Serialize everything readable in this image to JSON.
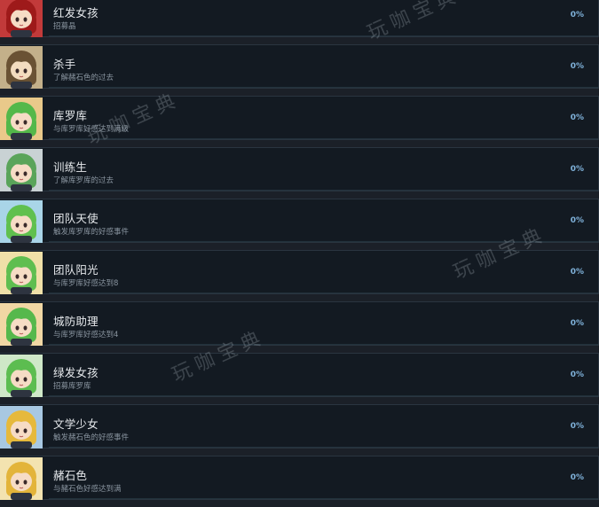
{
  "achievements": [
    {
      "title": "红发女孩",
      "desc": "招募晶",
      "percent": "0%",
      "avatar_icon": "red-hair-girl-portrait",
      "bg": "#c23a3a",
      "hair": "#9e1a1a",
      "skin": "#f6dcc5"
    },
    {
      "title": "杀手",
      "desc": "了解赭石色的过去",
      "percent": "0%",
      "avatar_icon": "assassin-portrait",
      "bg": "#c3b08a",
      "hair": "#6a5234",
      "skin": "#f3dcbf"
    },
    {
      "title": "库罗库",
      "desc": "与库罗库好感达到满级",
      "percent": "0%",
      "avatar_icon": "green-hair-girl-portrait",
      "bg": "#e9c98a",
      "hair": "#54b84a",
      "skin": "#f6dcc5"
    },
    {
      "title": "训练生",
      "desc": "了解库罗库的过去",
      "percent": "0%",
      "avatar_icon": "trainee-portrait",
      "bg": "#c9d2d4",
      "hair": "#5aa45a",
      "skin": "#f6dcc5"
    },
    {
      "title": "团队天使",
      "desc": "触发库罗库的好感事件",
      "percent": "0%",
      "avatar_icon": "green-hair-girl-portrait",
      "bg": "#a9d5e8",
      "hair": "#60c04e",
      "skin": "#f6dcc5"
    },
    {
      "title": "团队阳光",
      "desc": "与库罗库好感达到8",
      "percent": "0%",
      "avatar_icon": "green-hair-girl-portrait",
      "bg": "#f0e0a8",
      "hair": "#5fbe50",
      "skin": "#f6dcc5"
    },
    {
      "title": "城防助理",
      "desc": "与库罗库好感达到4",
      "percent": "0%",
      "avatar_icon": "green-hair-girl-portrait",
      "bg": "#f1d7a4",
      "hair": "#56b84c",
      "skin": "#f6dcc5"
    },
    {
      "title": "绿发女孩",
      "desc": "招募库罗库",
      "percent": "0%",
      "avatar_icon": "green-hair-girl-portrait",
      "bg": "#cfe8c8",
      "hair": "#5cbd50",
      "skin": "#f6dcc5"
    },
    {
      "title": "文学少女",
      "desc": "触发赭石色的好感事件",
      "percent": "0%",
      "avatar_icon": "blonde-girl-portrait",
      "bg": "#a8c8e2",
      "hair": "#e6b93c",
      "skin": "#f6dcc5"
    },
    {
      "title": "赭石色",
      "desc": "与赭石色好感达到满",
      "percent": "0%",
      "avatar_icon": "blonde-girl-portrait",
      "bg": "#f3e3b0",
      "hair": "#e3b43a",
      "skin": "#f6dcc5"
    }
  ],
  "watermark": "玩咖宝典"
}
